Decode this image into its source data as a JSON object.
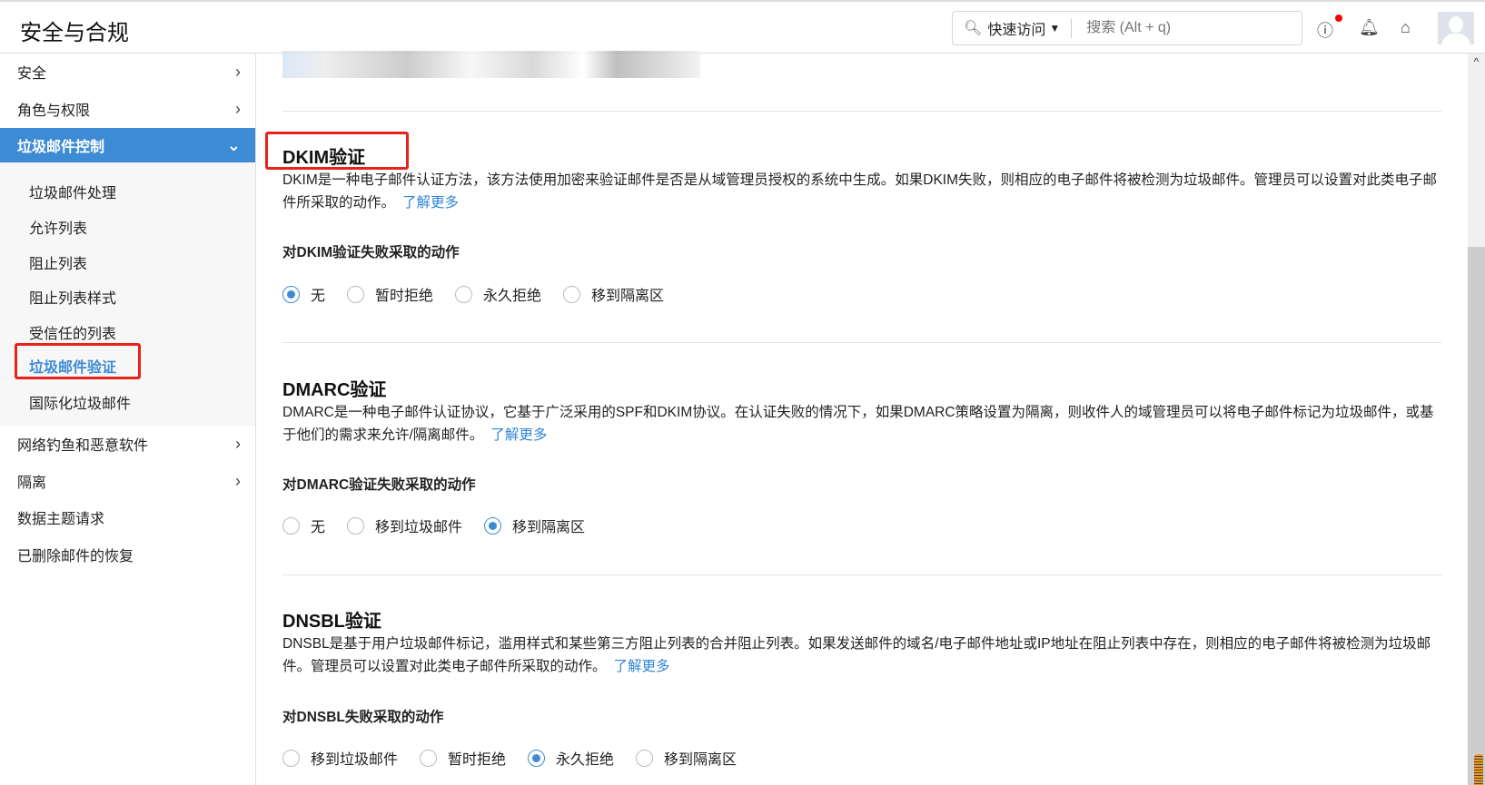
{
  "header": {
    "title": "安全与合规",
    "quick_access": "快速访问",
    "search_placeholder": "搜索 (Alt + q)"
  },
  "sidebar": {
    "items": [
      {
        "label": "安全"
      },
      {
        "label": "角色与权限"
      },
      {
        "label": "垃圾邮件控制"
      },
      {
        "label": "网络钓鱼和恶意软件"
      },
      {
        "label": "隔离"
      },
      {
        "label": "数据主题请求"
      },
      {
        "label": "已删除邮件的恢复"
      }
    ],
    "sub_items": [
      {
        "label": "垃圾邮件处理"
      },
      {
        "label": "允许列表"
      },
      {
        "label": "阻止列表"
      },
      {
        "label": "阻止列表样式"
      },
      {
        "label": "受信任的列表"
      },
      {
        "label": "垃圾邮件验证"
      },
      {
        "label": "国际化垃圾邮件"
      }
    ]
  },
  "sections": [
    {
      "title": "DKIM验证",
      "desc": "DKIM是一种电子邮件认证方法，该方法使用加密来验证邮件是否是从域管理员授权的系统中生成。如果DKIM失败，则相应的电子邮件将被检测为垃圾邮件。管理员可以设置对此类电子邮件所采取的动作。",
      "link": "了解更多",
      "action_label": "对DKIM验证失败采取的动作",
      "options": [
        "无",
        "暂时拒绝",
        "永久拒绝",
        "移到隔离区"
      ],
      "selected": "无"
    },
    {
      "title": "DMARC验证",
      "desc": "DMARC是一种电子邮件认证协议，它基于广泛采用的SPF和DKIM协议。在认证失败的情况下，如果DMARC策略设置为隔离，则收件人的域管理员可以将电子邮件标记为垃圾邮件，或基于他们的需求来允许/隔离邮件。",
      "link": "了解更多",
      "action_label": "对DMARC验证失败采取的动作",
      "options": [
        "无",
        "移到垃圾邮件",
        "移到隔离区"
      ],
      "selected": "移到隔离区"
    },
    {
      "title": "DNSBL验证",
      "desc": "DNSBL是基于用户垃圾邮件标记，滥用样式和某些第三方阻止列表的合并阻止列表。如果发送邮件的域名/电子邮件地址或IP地址在阻止列表中存在，则相应的电子邮件将被检测为垃圾邮件。管理员可以设置对此类电子邮件所采取的动作。",
      "link": "了解更多",
      "action_label": "对DNSBL失败采取的动作",
      "options": [
        "移到垃圾邮件",
        "暂时拒绝",
        "永久拒绝",
        "移到隔离区"
      ],
      "selected": "永久拒绝"
    }
  ],
  "colors": {
    "accent": "#3d8bd5",
    "highlight": "#e8211a"
  }
}
